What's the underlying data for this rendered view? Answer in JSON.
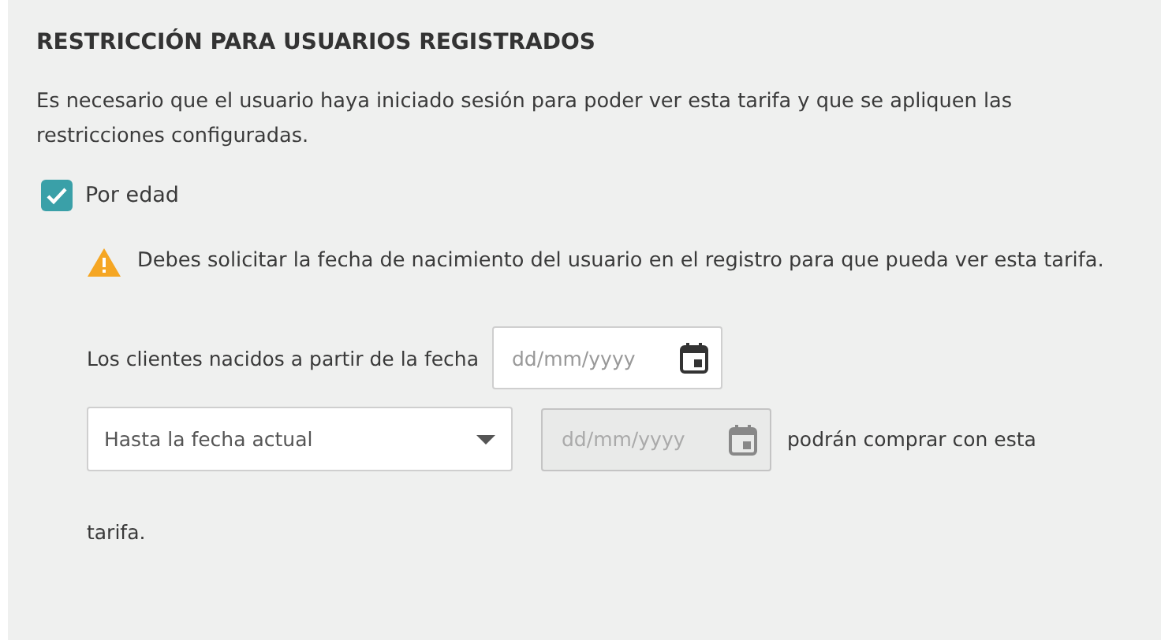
{
  "section": {
    "title": "RESTRICCIÓN PARA USUARIOS REGISTRADOS",
    "description": "Es necesario que el usuario haya iniciado sesión para poder ver esta tarifa y que se apliquen las restricciones configuradas."
  },
  "age_restriction": {
    "label": "Por edad",
    "checked": true,
    "warning": "Debes solicitar la fecha de nacimiento del usuario en el registro para que pueda ver esta tarifa.",
    "from_label": "Los clientes nacidos a partir de la fecha",
    "from_date": {
      "placeholder": "dd/mm/yyyy",
      "disabled": false
    },
    "until_select": {
      "value": "Hasta la fecha actual"
    },
    "until_date": {
      "placeholder": "dd/mm/yyyy",
      "disabled": true
    },
    "suffix": "podrán comprar con esta",
    "suffix_continued": "tarifa."
  }
}
